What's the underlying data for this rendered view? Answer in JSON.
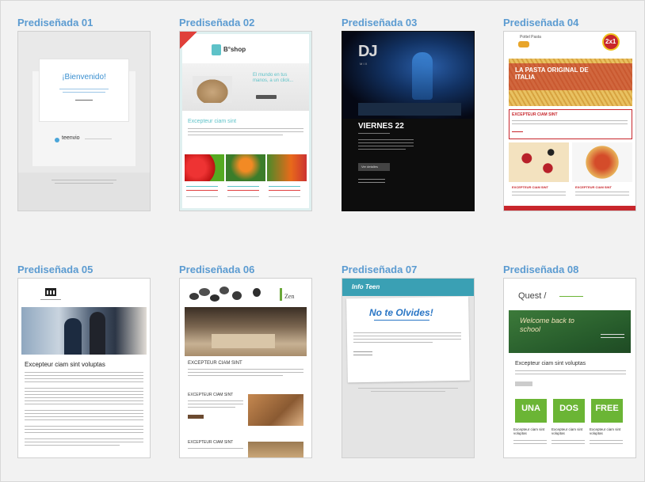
{
  "templates": [
    {
      "title": "Prediseñada 01",
      "texts": {
        "heading": "¡Bienvenido!",
        "brand": "teenvio"
      }
    },
    {
      "title": "Prediseñada 02",
      "texts": {
        "logo": "B°shop",
        "hero": "El mundo en tus manos, a un click...",
        "section": "Excepteur ciam sint"
      }
    },
    {
      "title": "Prediseñada 03",
      "texts": {
        "logo": "DJ",
        "sub": "M I X",
        "date": "VIERNES 22",
        "button": "Ver detalles"
      }
    },
    {
      "title": "Prediseñada 04",
      "texts": {
        "brand": "Pottel Pasta",
        "badge": "2x1",
        "hero": "LA PASTA ORIGINAL DE ITALIA",
        "section": "EXCEPTEUR CIAM SINT",
        "col1": "EXCEPTEUR CIAM SINT",
        "col2": "EXCEPTEUR CIAM SINT"
      }
    },
    {
      "title": "Prediseñada 05",
      "texts": {
        "heading": "Excepteur ciam sint voluptas"
      }
    },
    {
      "title": "Prediseñada 06",
      "texts": {
        "brand": "Zen",
        "heading": "EXCEPTEUR CIAM SINT",
        "sub1": "EXCEPTEUR CIAM SINT",
        "sub2": "EXCEPTEUR CIAM SINT"
      }
    },
    {
      "title": "Prediseñada 07",
      "texts": {
        "logo": "Info Teen",
        "heading": "No te Olvides!"
      }
    },
    {
      "title": "Prediseñada 08",
      "texts": {
        "brand": "Quest /",
        "board": "Welcome back to school",
        "heading": "Excepteur ciam sint voluptas",
        "b1": "UNA",
        "b2": "DOS",
        "b3": "FREE",
        "c1": "Excepteur ciam sint voluptas",
        "c2": "Excepteur ciam sint voluptas",
        "c3": "Excepteur ciam sint voluptas"
      }
    }
  ],
  "colors": {
    "title": "#5b9bd1",
    "teal": "#5ec2c8",
    "red": "#c8262c",
    "green": "#6bb535",
    "dark": "#111111"
  }
}
